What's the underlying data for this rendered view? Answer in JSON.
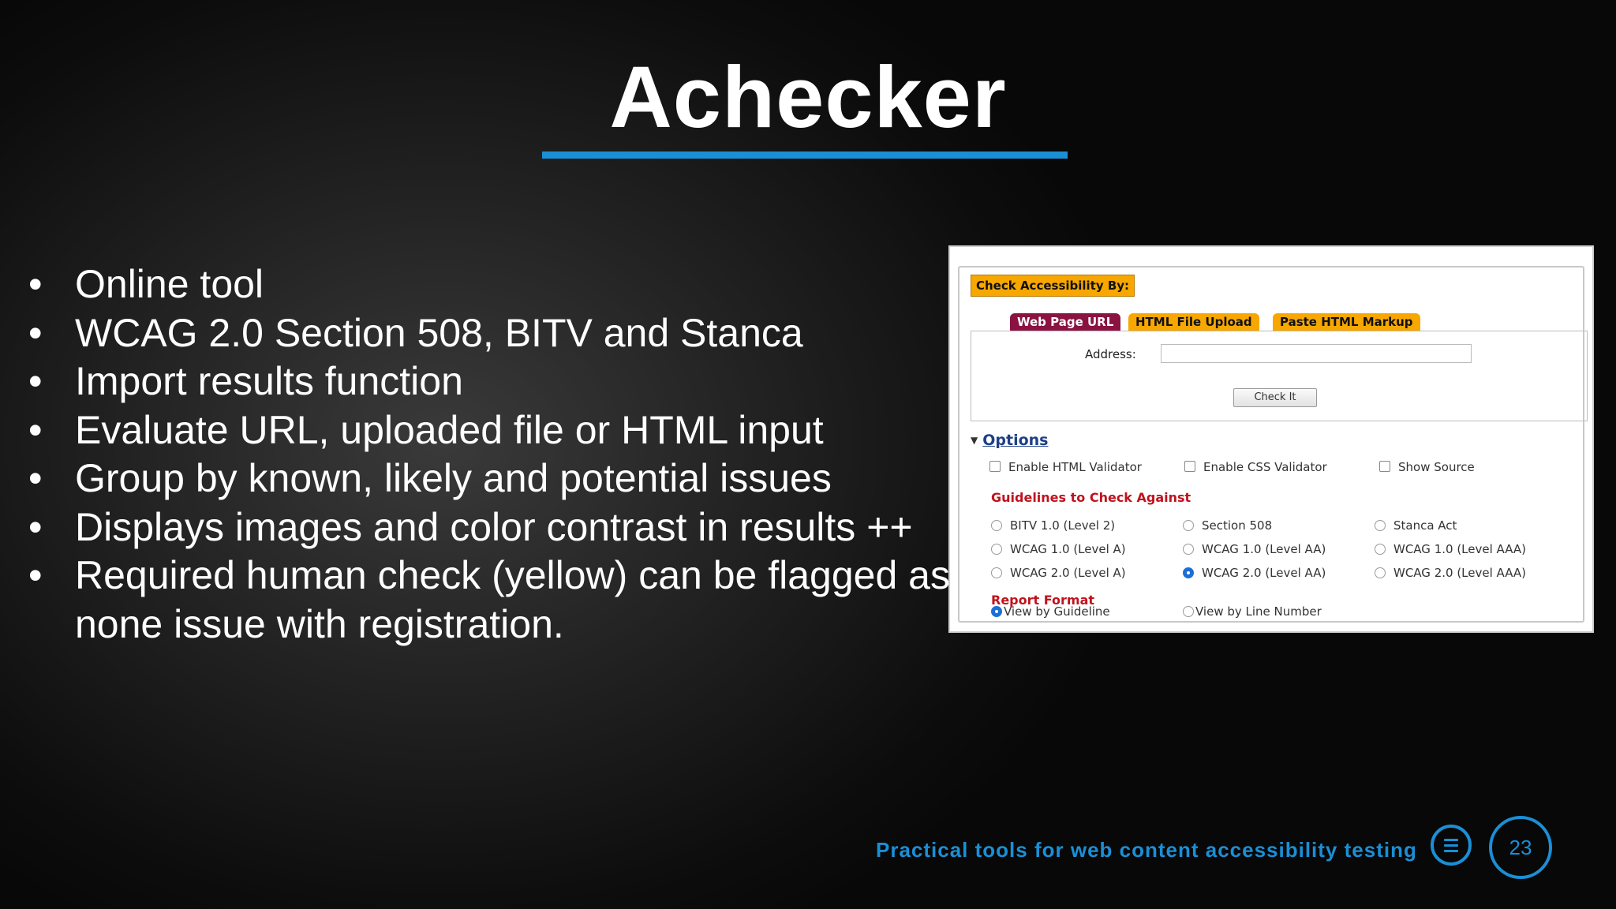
{
  "slide": {
    "title": "Achecker",
    "bullets": [
      "Online tool",
      "WCAG 2.0 Section 508, BITV and Stanca",
      "Import results function",
      "Evaluate URL, uploaded file or HTML input",
      "Group by known, likely and potential issues",
      "Displays images and color contrast in results ++",
      "Required human check (yellow) can be flagged as none issue with registration."
    ],
    "bullet_symbol": "•",
    "footer_text": "Practical tools for web content accessibility testing",
    "page_number": "23",
    "accent_color": "#1a8fd6"
  },
  "screenshot": {
    "legend": "Check Accessibility By:",
    "tabs": [
      "Web Page URL",
      "HTML File Upload",
      "Paste HTML Markup"
    ],
    "active_tab": "Web Page URL",
    "address_label": "Address:",
    "address_value": "",
    "check_button": "Check It",
    "options_label": "Options",
    "validators": [
      {
        "label": "Enable HTML Validator",
        "checked": false
      },
      {
        "label": "Enable CSS Validator",
        "checked": false
      },
      {
        "label": "Show Source",
        "checked": false
      }
    ],
    "guidelines_heading": "Guidelines to Check Against",
    "guidelines": [
      {
        "label": "BITV 1.0 (Level 2)",
        "selected": false
      },
      {
        "label": "Section 508",
        "selected": false
      },
      {
        "label": "Stanca Act",
        "selected": false
      },
      {
        "label": "WCAG 1.0 (Level A)",
        "selected": false
      },
      {
        "label": "WCAG 1.0 (Level AA)",
        "selected": false
      },
      {
        "label": "WCAG 1.0 (Level AAA)",
        "selected": false
      },
      {
        "label": "WCAG 2.0 (Level A)",
        "selected": false
      },
      {
        "label": "WCAG 2.0 (Level AA)",
        "selected": true
      },
      {
        "label": "WCAG 2.0 (Level AAA)",
        "selected": false
      }
    ],
    "report_heading": "Report Format",
    "report_formats": [
      {
        "label": "View by Guideline",
        "selected": true
      },
      {
        "label": "View by Line Number",
        "selected": false
      }
    ]
  }
}
